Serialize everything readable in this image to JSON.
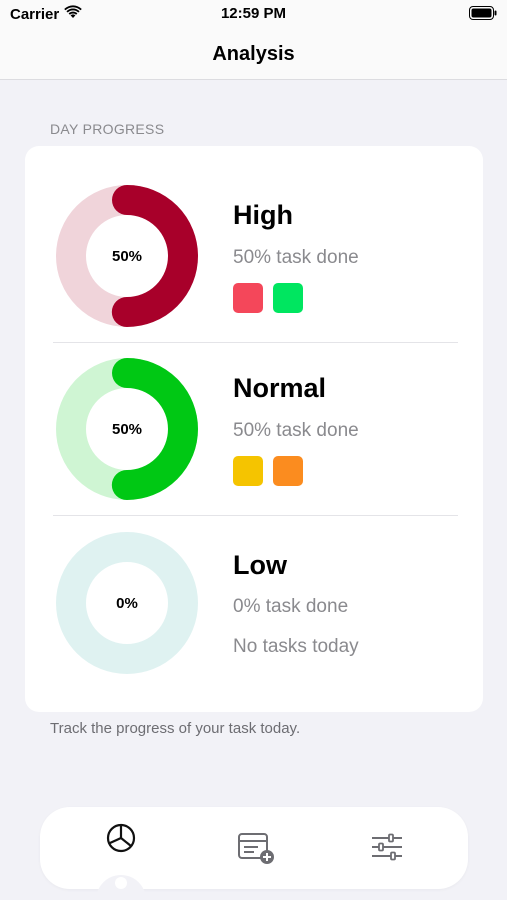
{
  "status_bar": {
    "carrier": "Carrier",
    "time": "12:59 PM",
    "icons": [
      "wifi-icon",
      "battery-icon"
    ]
  },
  "nav": {
    "title": "Analysis"
  },
  "section": {
    "header": "DAY PROGRESS",
    "footer": "Track the progress of your task today."
  },
  "priorities": [
    {
      "name": "High",
      "percent_label": "50%",
      "progress": 0.5,
      "subtitle": "50% task done",
      "ring_color": "#a8002a",
      "track_color": "#f0d4da",
      "swatches": [
        "#f4475a",
        "#00e660"
      ],
      "note": ""
    },
    {
      "name": "Normal",
      "percent_label": "50%",
      "progress": 0.5,
      "subtitle": "50% task done",
      "ring_color": "#00c814",
      "track_color": "#cff5d3",
      "swatches": [
        "#f5c400",
        "#fb8c1f"
      ],
      "note": ""
    },
    {
      "name": "Low",
      "percent_label": "0%",
      "progress": 0,
      "subtitle": "0% task done",
      "ring_color": "#5cc6c6",
      "track_color": "#dff2f1",
      "swatches": [],
      "note": "No tasks today"
    }
  ],
  "tab_bar": {
    "tabs": [
      {
        "icon": "pie-chart-icon",
        "selected": true
      },
      {
        "icon": "calendar-add-icon",
        "selected": false
      },
      {
        "icon": "sliders-icon",
        "selected": false
      }
    ]
  }
}
